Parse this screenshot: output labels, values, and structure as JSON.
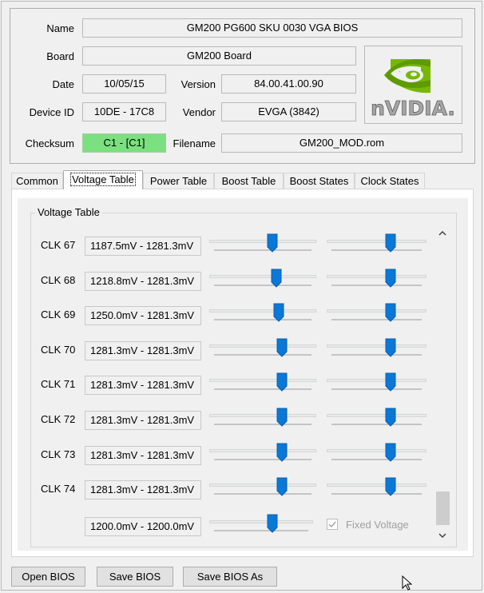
{
  "info": {
    "name_label": "Name",
    "name_value": "GM200 PG600 SKU 0030 VGA BIOS",
    "board_label": "Board",
    "board_value": "GM200 Board",
    "date_label": "Date",
    "date_value": "10/05/15",
    "version_label": "Version",
    "version_value": "84.00.41.00.90",
    "device_id_label": "Device ID",
    "device_id_value": "10DE - 17C8",
    "vendor_label": "Vendor",
    "vendor_value": "EVGA (3842)",
    "checksum_label": "Checksum",
    "checksum_value": "C1 - [C1]",
    "filename_label": "Filename",
    "filename_value": "GM200_MOD.rom",
    "logo_text": "nVIDIA."
  },
  "tabs": [
    {
      "label": "Common"
    },
    {
      "label": "Voltage Table",
      "active": true
    },
    {
      "label": "Power Table"
    },
    {
      "label": "Boost Table"
    },
    {
      "label": "Boost States"
    },
    {
      "label": "Clock States"
    }
  ],
  "voltage_table": {
    "title": "Voltage Table",
    "rows": [
      {
        "label": "CLK 67",
        "value": "1187.5mV - 1281.3mV",
        "min_slider": 0.6,
        "max_slider": 0.66
      },
      {
        "label": "CLK 68",
        "value": "1218.8mV - 1281.3mV",
        "min_slider": 0.64,
        "max_slider": 0.66
      },
      {
        "label": "CLK 69",
        "value": "1250.0mV - 1281.3mV",
        "min_slider": 0.67,
        "max_slider": 0.66
      },
      {
        "label": "CLK 70",
        "value": "1281.3mV - 1281.3mV",
        "min_slider": 0.7,
        "max_slider": 0.66
      },
      {
        "label": "CLK 71",
        "value": "1281.3mV - 1281.3mV",
        "min_slider": 0.7,
        "max_slider": 0.66
      },
      {
        "label": "CLK 72",
        "value": "1281.3mV - 1281.3mV",
        "min_slider": 0.7,
        "max_slider": 0.66
      },
      {
        "label": "CLK 73",
        "value": "1281.3mV - 1281.3mV",
        "min_slider": 0.7,
        "max_slider": 0.66
      },
      {
        "label": "CLK 74",
        "value": "1281.3mV - 1281.3mV",
        "min_slider": 0.7,
        "max_slider": 0.66
      }
    ],
    "fixed_row": {
      "value": "1200.0mV - 1200.0mV",
      "slider": 0.62
    },
    "fixed_voltage_label": "Fixed Voltage",
    "fixed_voltage_checked": true
  },
  "buttons": {
    "open": "Open BIOS",
    "save": "Save BIOS",
    "save_as": "Save BIOS As"
  },
  "colors": {
    "checksum_ok": "#7be07f",
    "slider_thumb": "#0a78d7",
    "nvidia_green": "#76b900"
  }
}
